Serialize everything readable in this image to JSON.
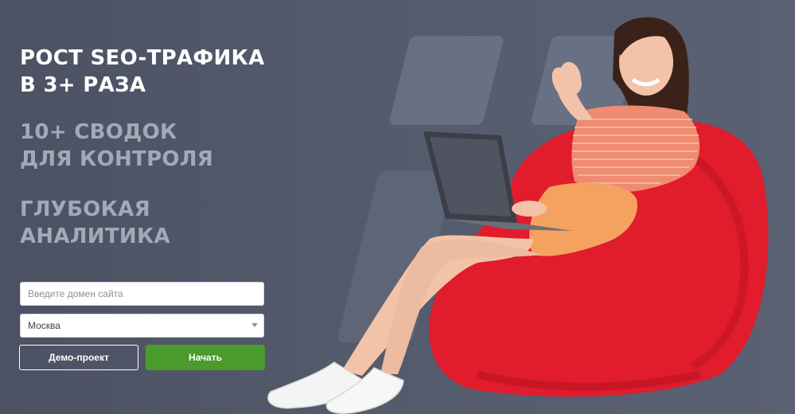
{
  "headlines": {
    "primary": [
      "РОСТ SEO-ТРАФИКА",
      "В 3+ РАЗА"
    ],
    "secondary_1": [
      "10+ СВОДОК",
      "ДЛЯ КОНТРОЛЯ"
    ],
    "secondary_2": [
      "ГЛУБОКАЯ",
      "АНАЛИТИКА"
    ]
  },
  "form": {
    "domain_placeholder": "Введите домен сайта",
    "city_selected": "Москва",
    "demo_button": "Демо-проект",
    "start_button": "Начать"
  },
  "colors": {
    "background": "#4f5566",
    "primary_text": "#ffffff",
    "secondary_text": "#a3a9b6",
    "start_button": "#4a9a2c",
    "beanbag": "#e31b2e"
  },
  "icons": {
    "select_caret": "chevron-down-icon"
  }
}
